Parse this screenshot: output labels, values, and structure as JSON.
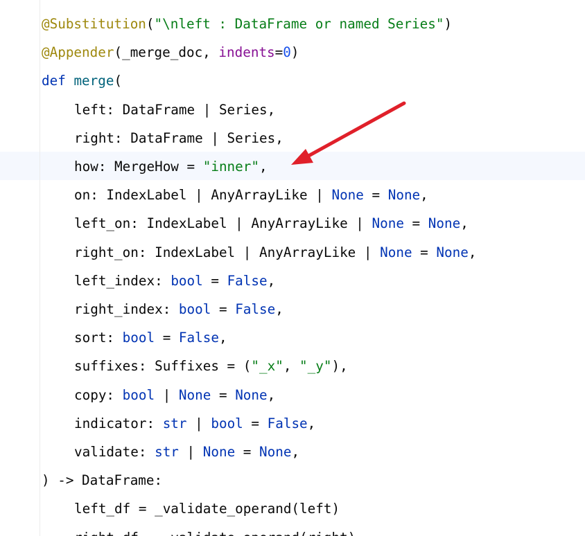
{
  "editor": {
    "lines": [
      {
        "indent": false,
        "tokens": [
          {
            "t": "@Substitution",
            "c": "deco"
          },
          {
            "t": "(",
            "c": "plain"
          },
          {
            "t": "\"\\nleft : DataFrame or named Series\"",
            "c": "str"
          },
          {
            "t": ")",
            "c": "plain"
          }
        ]
      },
      {
        "indent": false,
        "tokens": [
          {
            "t": "@Appender",
            "c": "deco"
          },
          {
            "t": "(_merge_doc, ",
            "c": "plain"
          },
          {
            "t": "indents",
            "c": "param"
          },
          {
            "t": "=",
            "c": "plain"
          },
          {
            "t": "0",
            "c": "num"
          },
          {
            "t": ")",
            "c": "plain"
          }
        ]
      },
      {
        "indent": false,
        "tokens": [
          {
            "t": "def ",
            "c": "kw"
          },
          {
            "t": "merge",
            "c": "fn"
          },
          {
            "t": "(",
            "c": "plain"
          }
        ]
      },
      {
        "indent": true,
        "tokens": [
          {
            "t": "left: DataFrame | Series,",
            "c": "plain"
          }
        ]
      },
      {
        "indent": true,
        "tokens": [
          {
            "t": "right: DataFrame | Series,",
            "c": "plain"
          }
        ]
      },
      {
        "indent": true,
        "current": true,
        "tokens": [
          {
            "t": "how: MergeHow = ",
            "c": "plain"
          },
          {
            "t": "\"inner\"",
            "c": "str"
          },
          {
            "t": ",",
            "c": "plain"
          }
        ]
      },
      {
        "indent": true,
        "tokens": [
          {
            "t": "on: IndexLabel | AnyArrayLike | ",
            "c": "plain"
          },
          {
            "t": "None",
            "c": "kw"
          },
          {
            "t": " = ",
            "c": "plain"
          },
          {
            "t": "None",
            "c": "kw"
          },
          {
            "t": ",",
            "c": "plain"
          }
        ]
      },
      {
        "indent": true,
        "tokens": [
          {
            "t": "left_on: IndexLabel | AnyArrayLike | ",
            "c": "plain"
          },
          {
            "t": "None",
            "c": "kw"
          },
          {
            "t": " = ",
            "c": "plain"
          },
          {
            "t": "None",
            "c": "kw"
          },
          {
            "t": ",",
            "c": "plain"
          }
        ]
      },
      {
        "indent": true,
        "tokens": [
          {
            "t": "right_on: IndexLabel | AnyArrayLike | ",
            "c": "plain"
          },
          {
            "t": "None",
            "c": "kw"
          },
          {
            "t": " = ",
            "c": "plain"
          },
          {
            "t": "None",
            "c": "kw"
          },
          {
            "t": ",",
            "c": "plain"
          }
        ]
      },
      {
        "indent": true,
        "tokens": [
          {
            "t": "left_index: ",
            "c": "plain"
          },
          {
            "t": "bool",
            "c": "kw"
          },
          {
            "t": " = ",
            "c": "plain"
          },
          {
            "t": "False",
            "c": "kw"
          },
          {
            "t": ",",
            "c": "plain"
          }
        ]
      },
      {
        "indent": true,
        "tokens": [
          {
            "t": "right_index: ",
            "c": "plain"
          },
          {
            "t": "bool",
            "c": "kw"
          },
          {
            "t": " = ",
            "c": "plain"
          },
          {
            "t": "False",
            "c": "kw"
          },
          {
            "t": ",",
            "c": "plain"
          }
        ]
      },
      {
        "indent": true,
        "tokens": [
          {
            "t": "sort: ",
            "c": "plain"
          },
          {
            "t": "bool",
            "c": "kw"
          },
          {
            "t": " = ",
            "c": "plain"
          },
          {
            "t": "False",
            "c": "kw"
          },
          {
            "t": ",",
            "c": "plain"
          }
        ]
      },
      {
        "indent": true,
        "tokens": [
          {
            "t": "suffixes: Suffixes = (",
            "c": "plain"
          },
          {
            "t": "\"_x\"",
            "c": "str"
          },
          {
            "t": ", ",
            "c": "plain"
          },
          {
            "t": "\"_y\"",
            "c": "str"
          },
          {
            "t": "),",
            "c": "plain"
          }
        ]
      },
      {
        "indent": true,
        "tokens": [
          {
            "t": "copy: ",
            "c": "plain"
          },
          {
            "t": "bool",
            "c": "kw"
          },
          {
            "t": " | ",
            "c": "plain"
          },
          {
            "t": "None",
            "c": "kw"
          },
          {
            "t": " = ",
            "c": "plain"
          },
          {
            "t": "None",
            "c": "kw"
          },
          {
            "t": ",",
            "c": "plain"
          }
        ]
      },
      {
        "indent": true,
        "tokens": [
          {
            "t": "indicator: ",
            "c": "plain"
          },
          {
            "t": "str",
            "c": "kw"
          },
          {
            "t": " | ",
            "c": "plain"
          },
          {
            "t": "bool",
            "c": "kw"
          },
          {
            "t": " = ",
            "c": "plain"
          },
          {
            "t": "False",
            "c": "kw"
          },
          {
            "t": ",",
            "c": "plain"
          }
        ]
      },
      {
        "indent": true,
        "tokens": [
          {
            "t": "validate: ",
            "c": "plain"
          },
          {
            "t": "str",
            "c": "kw"
          },
          {
            "t": " | ",
            "c": "plain"
          },
          {
            "t": "None",
            "c": "kw"
          },
          {
            "t": " = ",
            "c": "plain"
          },
          {
            "t": "None",
            "c": "kw"
          },
          {
            "t": ",",
            "c": "plain"
          }
        ]
      },
      {
        "indent": false,
        "tokens": [
          {
            "t": ") -> DataFrame:",
            "c": "plain"
          }
        ]
      },
      {
        "indent": true,
        "tokens": [
          {
            "t": "left_df = _validate_operand(left)",
            "c": "plain"
          }
        ]
      },
      {
        "indent": true,
        "tokens": [
          {
            "t": "right_df = _validate_operand(right)",
            "c": "plain"
          }
        ]
      }
    ]
  },
  "colors": {
    "background": "#ffffff",
    "current_line": "#f5f8fe",
    "arrow": "#e0202a",
    "decorator": "#9e880d",
    "string": "#067d17",
    "keyword": "#0033b3",
    "function": "#00627a",
    "parameter": "#871094",
    "number": "#1750eb"
  },
  "annotation": {
    "icon": "red-arrow-icon"
  }
}
